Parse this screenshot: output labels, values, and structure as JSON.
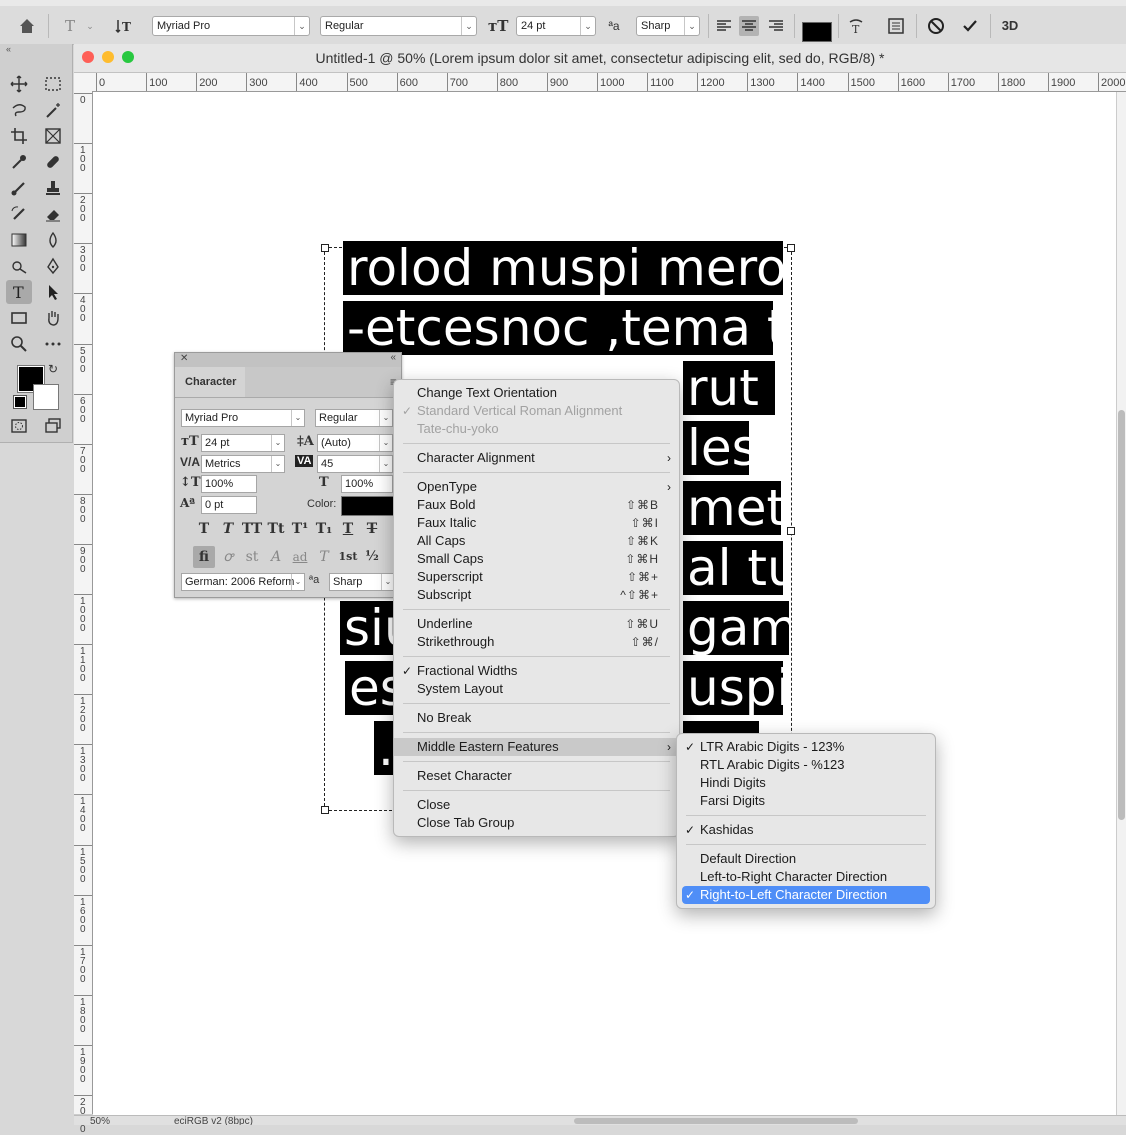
{
  "options_bar": {
    "font_family": "Myriad Pro",
    "font_style": "Regular",
    "font_size": "24 pt",
    "antialias": "Sharp",
    "threeD_label": "3D",
    "text_color": "#000000"
  },
  "document": {
    "title": "Untitled-1 @ 50% (Lorem ipsum dolor sit amet, consectetur adipiscing elit, sed do, RGB/8) *",
    "ruler_h_labels": [
      "0",
      "100",
      "200",
      "300",
      "400",
      "500",
      "600",
      "700",
      "800",
      "900",
      "1000",
      "1100",
      "1200",
      "1300",
      "1400",
      "1500",
      "1600",
      "1700",
      "1800",
      "1900",
      "2000"
    ],
    "ruler_v_labels": [
      "0",
      "100",
      "200",
      "300",
      "400",
      "500",
      "600",
      "700",
      "800",
      "900",
      "1000",
      "1100",
      "1200",
      "1300",
      "1400",
      "1500",
      "1600",
      "1700",
      "1800",
      "1900",
      "2000"
    ],
    "status_zoom": "50%",
    "status_profile": "eciRGB v2 (8bpc)",
    "text_lines": [
      "rolod muspi meroL",
      "-etcesnoc ,tema tis",
      "rut",
      "les",
      "met",
      "al tu",
      "siu",
      "gam",
      "es",
      "uspi",
      ".a"
    ]
  },
  "character_panel": {
    "tab_label": "Character",
    "font_family": "Myriad Pro",
    "font_style": "Regular",
    "font_size": "24 pt",
    "leading": "(Auto)",
    "kerning": "Metrics",
    "tracking": "45",
    "vertical_scale": "100%",
    "horizontal_scale": "100%",
    "baseline_shift": "0 pt",
    "color_label": "Color:",
    "language": "German: 2006 Reform",
    "antialias": "Sharp",
    "style_buttons": [
      "T",
      "T",
      "TT",
      "Tt",
      "T¹",
      "T₁",
      "T",
      "T"
    ],
    "opentype_buttons": [
      "fi",
      "ꝍ",
      "st",
      "A",
      "ad",
      "T",
      "1st",
      "½"
    ]
  },
  "context_menu": {
    "items": [
      {
        "label": "Change Text Orientation"
      },
      {
        "label": "Standard Vertical Roman Alignment",
        "checked": true,
        "disabled": true
      },
      {
        "label": "Tate-chu-yoko",
        "disabled": true
      },
      {
        "sep": true
      },
      {
        "label": "Character Alignment",
        "submenu": true
      },
      {
        "sep": true
      },
      {
        "label": "OpenType",
        "submenu": true
      },
      {
        "label": "Faux Bold",
        "shortcut": "⇧⌘B"
      },
      {
        "label": "Faux Italic",
        "shortcut": "⇧⌘I"
      },
      {
        "label": "All Caps",
        "shortcut": "⇧⌘K"
      },
      {
        "label": "Small Caps",
        "shortcut": "⇧⌘H"
      },
      {
        "label": "Superscript",
        "shortcut": "⇧⌘+"
      },
      {
        "label": "Subscript",
        "shortcut": "^⇧⌘+"
      },
      {
        "sep": true
      },
      {
        "label": "Underline",
        "shortcut": "⇧⌘U"
      },
      {
        "label": "Strikethrough",
        "shortcut": "⇧⌘/"
      },
      {
        "sep": true
      },
      {
        "label": "Fractional Widths",
        "checked": true
      },
      {
        "label": "System Layout"
      },
      {
        "sep": true
      },
      {
        "label": "No Break"
      },
      {
        "sep": true
      },
      {
        "label": "Middle Eastern Features",
        "submenu": true,
        "highlighted": true
      },
      {
        "sep": true
      },
      {
        "label": "Reset Character"
      },
      {
        "sep": true
      },
      {
        "label": "Close"
      },
      {
        "label": "Close Tab Group"
      }
    ]
  },
  "submenu": {
    "items": [
      {
        "label": "LTR Arabic Digits - 123%",
        "checked": true
      },
      {
        "label": "RTL Arabic Digits - %123"
      },
      {
        "label": "Hindi Digits"
      },
      {
        "label": "Farsi Digits"
      },
      {
        "sep": true
      },
      {
        "label": "Kashidas",
        "checked": true
      },
      {
        "sep": true
      },
      {
        "label": "Default Direction"
      },
      {
        "label": "Left-to-Right Character Direction"
      },
      {
        "label": "Right-to-Left Character Direction",
        "checked": true,
        "active": true
      }
    ]
  }
}
